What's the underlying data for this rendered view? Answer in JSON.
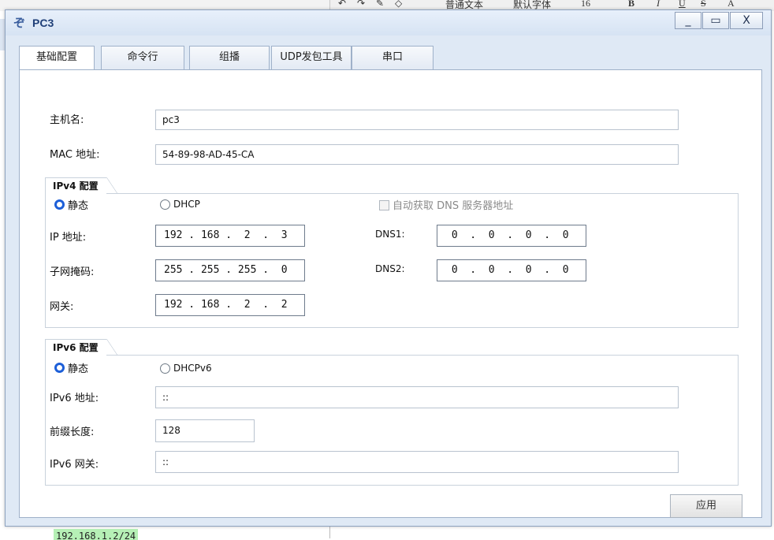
{
  "background": {
    "toolbar": {
      "style_select": "普通文本",
      "font_select": "默认字体",
      "size_select": "16",
      "bold": "B",
      "italic": "I",
      "underline": "U",
      "strike": "S",
      "font_color": "A"
    },
    "code_snippet": "192.168.1.2/24"
  },
  "window": {
    "title": "PC3",
    "controls": {
      "minimize": "_",
      "maximize": "▭",
      "close": "X"
    }
  },
  "tabs": [
    {
      "label": "基础配置",
      "active": true
    },
    {
      "label": "命令行"
    },
    {
      "label": "组播"
    },
    {
      "label": "UDP发包工具"
    },
    {
      "label": "串口"
    }
  ],
  "basic": {
    "hostname_label": "主机名:",
    "hostname_value": "pc3",
    "mac_label": "MAC 地址:",
    "mac_value": "54-89-98-AD-45-CA"
  },
  "ipv4": {
    "group_title": "IPv4 配置",
    "static_label": "静态",
    "dhcp_label": "DHCP",
    "auto_dns_label": "自动获取 DNS 服务器地址",
    "ip_label": "IP 地址:",
    "ip_value": "192 . 168 .  2  .  3",
    "mask_label": "子网掩码:",
    "mask_value": "255 . 255 . 255 .  0",
    "gateway_label": "网关:",
    "gateway_value": "192 . 168 .  2  .  2",
    "dns1_label": "DNS1:",
    "dns1_value": " 0  .  0  .  0  .  0",
    "dns2_label": "DNS2:",
    "dns2_value": " 0  .  0  .  0  .  0"
  },
  "ipv6": {
    "group_title": "IPv6 配置",
    "static_label": "静态",
    "dhcp_label": "DHCPv6",
    "addr_label": "IPv6 地址:",
    "addr_value": "::",
    "prefix_label": "前缀长度:",
    "prefix_value": "128",
    "gateway_label": "IPv6 网关:",
    "gateway_value": "::"
  },
  "apply_label": "应用",
  "colors": {
    "accent": "#1d5fd8",
    "title_text": "#1f3f78",
    "window_bg": "#dfe9f5"
  }
}
